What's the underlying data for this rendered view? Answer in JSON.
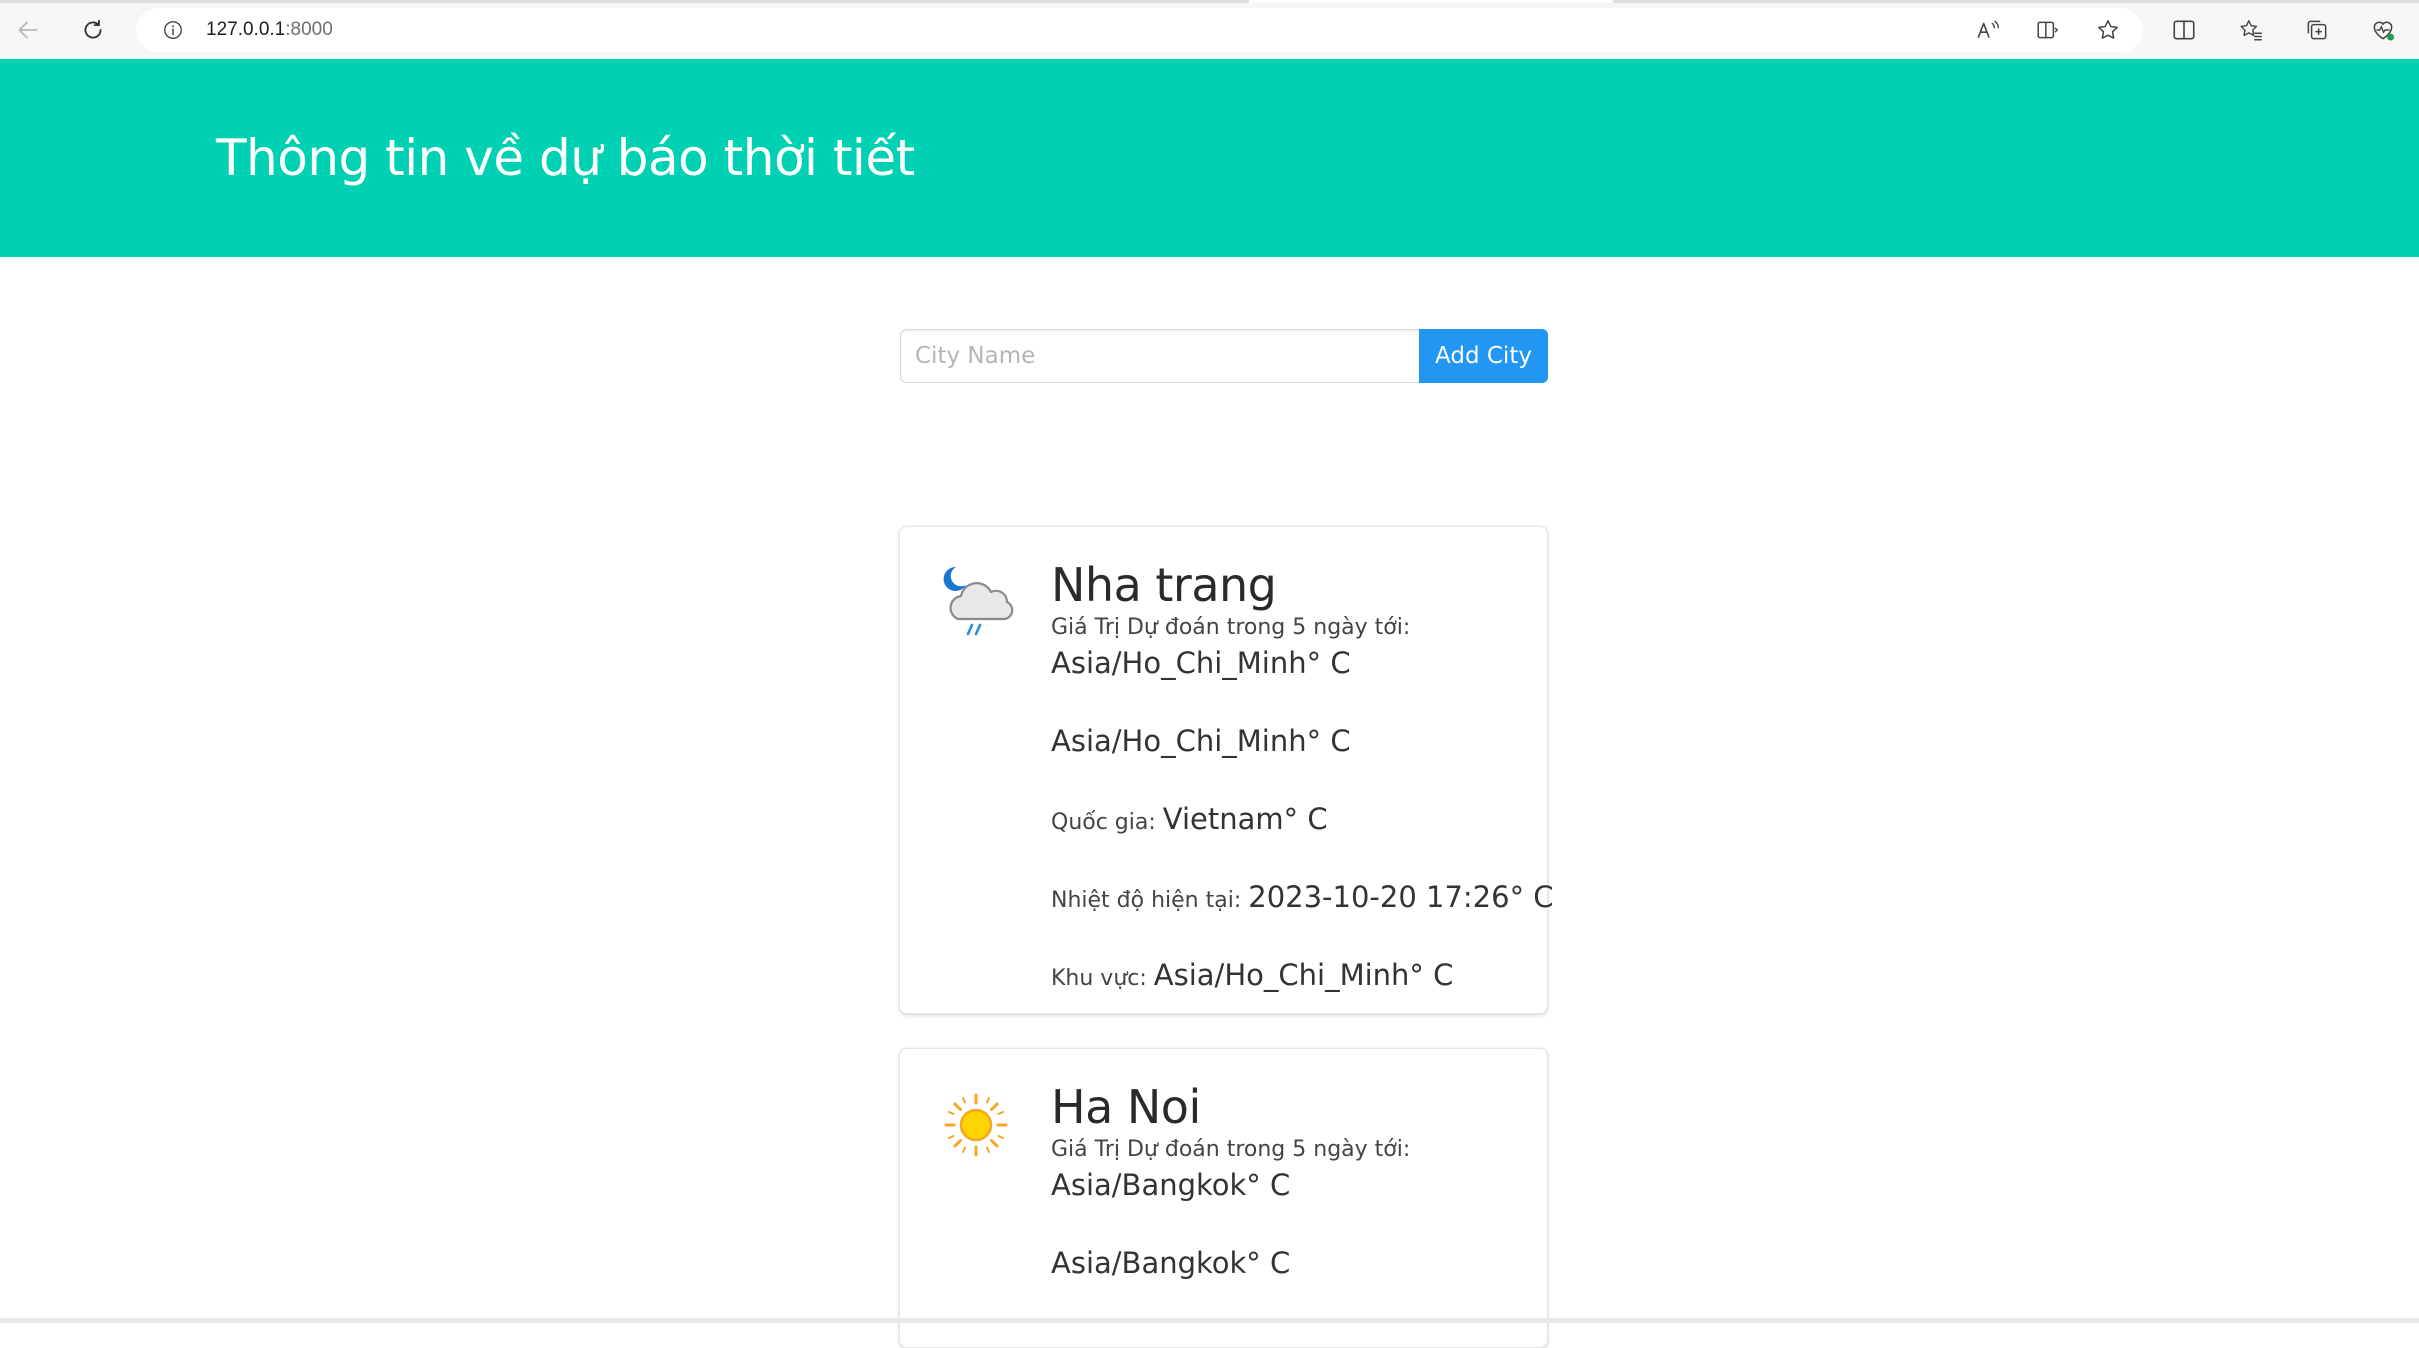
{
  "browser": {
    "url_host": "127.0.0.1",
    "url_port": ":8000",
    "icons": [
      "back-arrow-icon",
      "refresh-icon",
      "info-icon",
      "read-aloud-icon",
      "immersive-reader-icon",
      "favorite-star-icon",
      "split-screen-icon",
      "favorites-icon",
      "collections-icon",
      "browser-essentials-icon"
    ]
  },
  "hero": {
    "title": "Thông tin về dự báo thời tiết",
    "background": "#00d1b2"
  },
  "form": {
    "placeholder": "City Name",
    "value": "",
    "button_label": "Add City",
    "button_color": "#2196f3"
  },
  "cards": [
    {
      "icon": "night-cloud-rain-icon",
      "city": "Nha trang",
      "forecast_label": "Giá Trị Dự đoán trong 5 ngày tới:",
      "rows": [
        {
          "label": "",
          "value": "Asia/Ho_Chi_Minh° C"
        },
        {
          "label": "",
          "value": "Asia/Ho_Chi_Minh° C"
        },
        {
          "label": "Quốc gia: ",
          "value": "Vietnam° C"
        },
        {
          "label": "Nhiệt độ hiện tại: ",
          "value": "2023-10-20 17:26° C"
        },
        {
          "label": "Khu vực: ",
          "value": "Asia/Ho_Chi_Minh° C"
        }
      ]
    },
    {
      "icon": "sun-icon",
      "city": "Ha Noi",
      "forecast_label": "Giá Trị Dự đoán trong 5 ngày tới:",
      "rows": [
        {
          "label": "",
          "value": "Asia/Bangkok° C"
        },
        {
          "label": "",
          "value": "Asia/Bangkok° C"
        }
      ]
    }
  ]
}
